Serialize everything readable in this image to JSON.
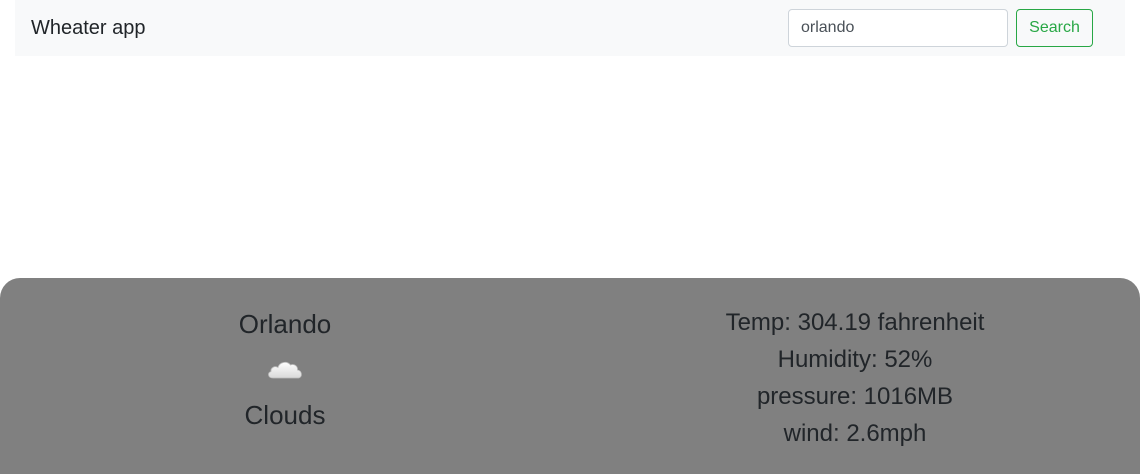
{
  "navbar": {
    "brand": "Wheater app",
    "search": {
      "value": "orlando",
      "placeholder": "Search"
    },
    "search_button_label": "Search"
  },
  "weather": {
    "city": "Orlando",
    "icon": "cloud-icon",
    "condition": "Clouds",
    "temp": "Temp: 304.19 fahrenheit",
    "humidity": "Humidity: 52%",
    "pressure": "pressure: 1016MB",
    "wind": "wind: 2.6mph"
  },
  "colors": {
    "navbar_bg": "#f8f9fa",
    "card_bg": "#808080",
    "success": "#28a745"
  }
}
